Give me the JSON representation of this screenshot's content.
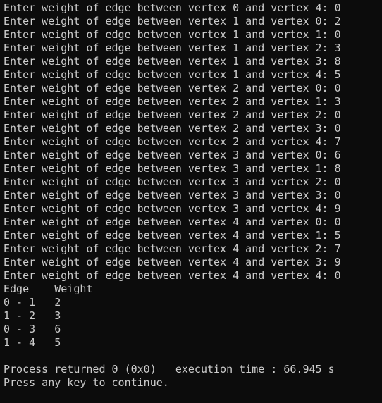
{
  "console": {
    "lines": [
      "Enter weight of edge between vertex 0 and vertex 4: 0",
      "Enter weight of edge between vertex 1 and vertex 0: 2",
      "Enter weight of edge between vertex 1 and vertex 1: 0",
      "Enter weight of edge between vertex 1 and vertex 2: 3",
      "Enter weight of edge between vertex 1 and vertex 3: 8",
      "Enter weight of edge between vertex 1 and vertex 4: 5",
      "Enter weight of edge between vertex 2 and vertex 0: 0",
      "Enter weight of edge between vertex 2 and vertex 1: 3",
      "Enter weight of edge between vertex 2 and vertex 2: 0",
      "Enter weight of edge between vertex 2 and vertex 3: 0",
      "Enter weight of edge between vertex 2 and vertex 4: 7",
      "Enter weight of edge between vertex 3 and vertex 0: 6",
      "Enter weight of edge between vertex 3 and vertex 1: 8",
      "Enter weight of edge between vertex 3 and vertex 2: 0",
      "Enter weight of edge between vertex 3 and vertex 3: 0",
      "Enter weight of edge between vertex 3 and vertex 4: 9",
      "Enter weight of edge between vertex 4 and vertex 0: 0",
      "Enter weight of edge between vertex 4 and vertex 1: 5",
      "Enter weight of edge between vertex 4 and vertex 2: 7",
      "Enter weight of edge between vertex 4 and vertex 3: 9",
      "Enter weight of edge between vertex 4 and vertex 4: 0",
      "Edge    Weight",
      "0 - 1   2",
      "1 - 2   3",
      "0 - 3   6",
      "1 - 4   5",
      "",
      "Process returned 0 (0x0)   execution time : 66.945 s",
      "Press any key to continue."
    ],
    "colors": {
      "background": "#0c0c0c",
      "foreground": "#cccccc"
    }
  }
}
